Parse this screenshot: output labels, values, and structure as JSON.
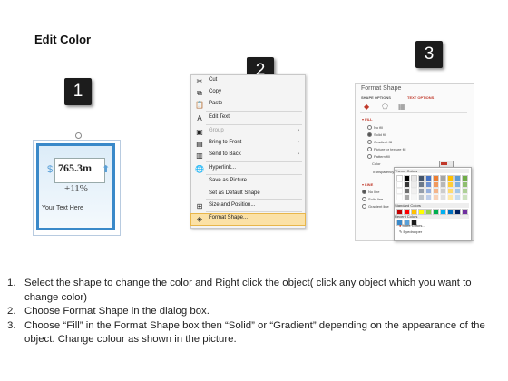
{
  "title": "Edit Color",
  "badges": [
    "1",
    "2",
    "3"
  ],
  "panel1": {
    "value": "765.3m",
    "percent": "+11%",
    "caption": "Your Text Here"
  },
  "context_menu": {
    "items": [
      {
        "label": "Cut",
        "icon": "scissors-icon",
        "glyph": "✂",
        "disabled": false,
        "submenu": false,
        "highlight": false
      },
      {
        "label": "Copy",
        "icon": "copy-icon",
        "glyph": "⧉",
        "disabled": false,
        "submenu": false,
        "highlight": false
      },
      {
        "label": "Paste",
        "icon": "paste-icon",
        "glyph": "📋",
        "disabled": false,
        "submenu": false,
        "highlight": false
      },
      {
        "label": "Edit Text",
        "icon": "edit-text-icon",
        "glyph": "A",
        "disabled": false,
        "submenu": false,
        "highlight": false
      },
      {
        "label": "Group",
        "icon": "group-icon",
        "glyph": "▣",
        "disabled": true,
        "submenu": true,
        "highlight": false
      },
      {
        "label": "Bring to Front",
        "icon": "bring-front-icon",
        "glyph": "▤",
        "disabled": false,
        "submenu": true,
        "highlight": false
      },
      {
        "label": "Send to Back",
        "icon": "send-back-icon",
        "glyph": "▥",
        "disabled": false,
        "submenu": true,
        "highlight": false
      },
      {
        "label": "Hyperlink...",
        "icon": "hyperlink-icon",
        "glyph": "🌐",
        "disabled": false,
        "submenu": false,
        "highlight": false
      },
      {
        "label": "Save as Picture...",
        "icon": "",
        "glyph": "",
        "disabled": false,
        "submenu": false,
        "highlight": false
      },
      {
        "label": "Set as Default Shape",
        "icon": "",
        "glyph": "",
        "disabled": false,
        "submenu": false,
        "highlight": false
      },
      {
        "label": "Size and Position...",
        "icon": "size-position-icon",
        "glyph": "⊞",
        "disabled": false,
        "submenu": false,
        "highlight": false
      },
      {
        "label": "Format Shape...",
        "icon": "format-shape-icon",
        "glyph": "◈",
        "disabled": false,
        "submenu": false,
        "highlight": true
      }
    ]
  },
  "format_pane": {
    "title": "Format Shape",
    "tabs": [
      "SHAPE OPTIONS",
      "TEXT OPTIONS"
    ],
    "fill_section": "FILL",
    "fill_options": [
      "No fill",
      "Solid fill",
      "Gradient fill",
      "Picture or texture fill",
      "Pattern fill"
    ],
    "color_label": "Color",
    "transparency_label": "Transparency",
    "line_section": "LINE",
    "line_options": [
      "No line",
      "Solid line",
      "Gradient line"
    ],
    "theme_colors_label": "Theme Colors",
    "standard_colors_label": "Standard Colors",
    "recent_colors_label": "Recent Colors",
    "more_colors": "More Colors...",
    "eyedropper": "Eyedropper",
    "accent_color": "#c0392b",
    "theme_row": [
      "#ffffff",
      "#000000",
      "#e7e6e6",
      "#44546a",
      "#4472c4",
      "#ed7d31",
      "#a5a5a5",
      "#ffc000",
      "#5b9bd5",
      "#70ad47"
    ],
    "standard_row": [
      "#c00000",
      "#ff0000",
      "#ffc000",
      "#ffff00",
      "#92d050",
      "#00b050",
      "#00b0f0",
      "#0070c0",
      "#002060",
      "#7030a0"
    ],
    "recent_row": [
      "#3a89c9",
      "#5aa0d8",
      "#1c1c1c"
    ]
  },
  "instructions": [
    {
      "num": "1.",
      "text": "Select the shape to change the color and Right click the object( click any object which you want to change color)"
    },
    {
      "num": "2.",
      "text": "Choose Format Shape in the dialog box."
    },
    {
      "num": "3.",
      "text": "Choose “Fill” in the Format Shape box then “Solid” or “Gradient” depending on the appearance of the object. Change colour as shown in the picture."
    }
  ]
}
